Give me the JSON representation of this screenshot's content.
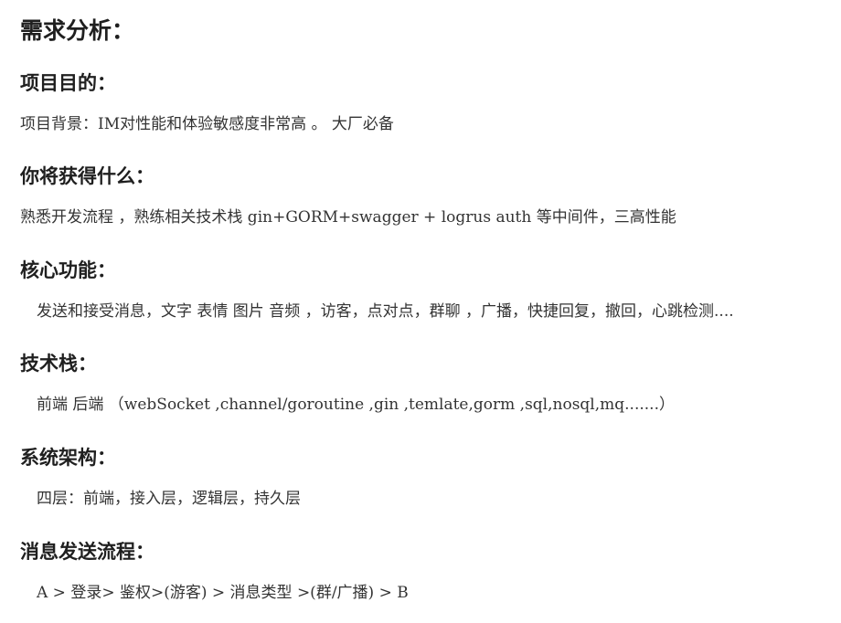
{
  "title": "需求分析：",
  "sections": [
    {
      "heading": "项目目的：",
      "body": "项目背景：IM对性能和体验敏感度非常高 。 大厂必备"
    },
    {
      "heading": "你将获得什么：",
      "body": "熟悉开发流程 ，熟练相关技术栈  gin+GORM+swagger + logrus auth 等中间件，三高性能"
    },
    {
      "heading": "核心功能：",
      "body": "发送和接受消息，文字 表情 图片 音频 ，访客，点对点，群聊 ，广播，快捷回复，撤回，心跳检测...."
    },
    {
      "heading": "技术栈：",
      "body": "前端  后端 （webSocket ,channel/goroutine  ,gin ,temlate,gorm ,sql,nosql,mq.......）"
    },
    {
      "heading": "系统架构：",
      "body": "四层：前端，接入层，逻辑层，持久层"
    },
    {
      "heading": "消息发送流程：",
      "body": "A > 登录>  鉴权>(游客)  >  消息类型  >(群/广播)  > B"
    }
  ]
}
